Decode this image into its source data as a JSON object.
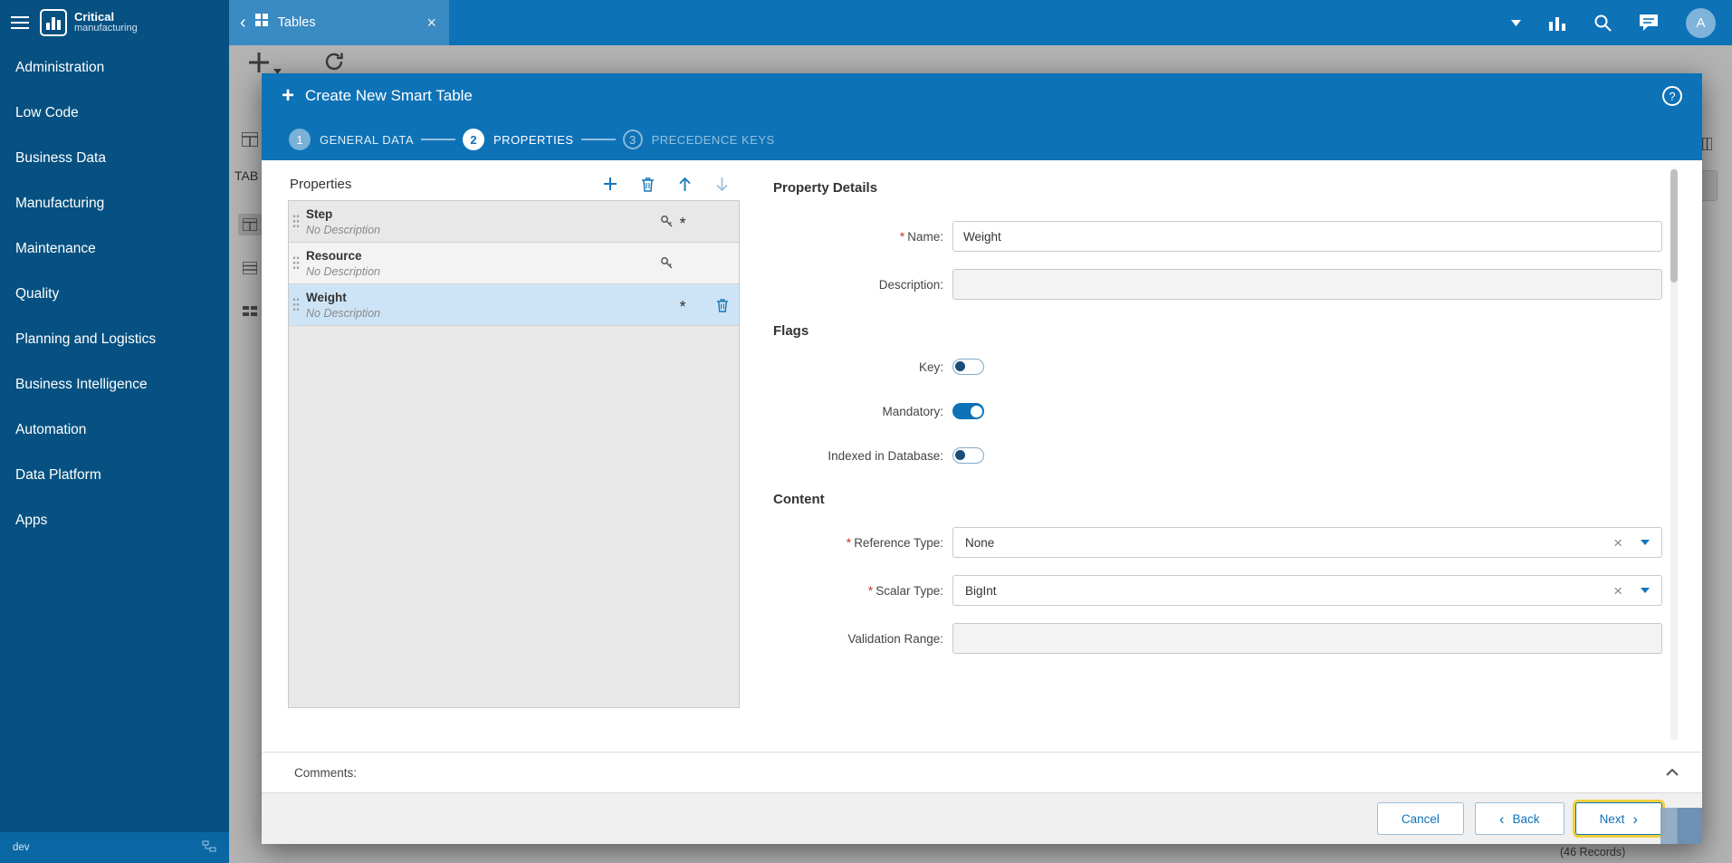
{
  "icons": {
    "plus": "+",
    "help": "?",
    "close": "×",
    "clear": "×",
    "required": "*",
    "back_chevron": "‹",
    "forward_chevron": "›"
  },
  "colors": {
    "topbar": "#0e72b7",
    "sidebar": "#065181",
    "accent": "#1677b8",
    "selected_row": "#cde4f6",
    "focus_ring": "#f2cf3e"
  },
  "sidebar": {
    "logo_primary": "Critical",
    "logo_secondary": "manufacturing",
    "items": [
      {
        "label": "Administration"
      },
      {
        "label": "Low Code"
      },
      {
        "label": "Business Data"
      },
      {
        "label": "Manufacturing"
      },
      {
        "label": "Maintenance"
      },
      {
        "label": "Quality"
      },
      {
        "label": "Planning and Logistics"
      },
      {
        "label": "Business Intelligence"
      },
      {
        "label": "Automation"
      },
      {
        "label": "Data Platform"
      },
      {
        "label": "Apps"
      }
    ],
    "environment": "dev"
  },
  "topbar": {
    "tab_label": "Tables",
    "avatar_initial": "A"
  },
  "background": {
    "page_title_partial": "TAB",
    "records_count": "(46 Records)"
  },
  "wizard": {
    "title": "Create New Smart Table",
    "steps": [
      {
        "number": "1",
        "label": "GENERAL DATA",
        "state": "completed"
      },
      {
        "number": "2",
        "label": "PROPERTIES",
        "state": "active"
      },
      {
        "number": "3",
        "label": "PRECEDENCE KEYS",
        "state": "upcoming"
      }
    ],
    "properties_panel": {
      "title": "Properties",
      "items": [
        {
          "name": "Step",
          "description": "No Description",
          "is_key": true,
          "is_mandatory": true,
          "selected": false
        },
        {
          "name": "Resource",
          "description": "No Description",
          "is_key": true,
          "is_mandatory": false,
          "selected": false
        },
        {
          "name": "Weight",
          "description": "No Description",
          "is_key": false,
          "is_mandatory": true,
          "selected": true
        }
      ]
    },
    "details": {
      "title": "Property Details",
      "sections": {
        "flags": "Flags",
        "content": "Content"
      },
      "fields": {
        "name": {
          "label": "Name:",
          "value": "Weight",
          "required": true
        },
        "description": {
          "label": "Description:",
          "value": "",
          "required": false
        },
        "reference_type": {
          "label": "Reference Type:",
          "value": "None",
          "required": true
        },
        "scalar_type": {
          "label": "Scalar Type:",
          "value": "BigInt",
          "required": true
        },
        "validation_range": {
          "label": "Validation Range:",
          "value": "",
          "required": false
        }
      },
      "toggles": {
        "key": {
          "label": "Key:",
          "on": false
        },
        "mandatory": {
          "label": "Mandatory:",
          "on": true
        },
        "indexed": {
          "label": "Indexed in Database:",
          "on": false
        }
      }
    },
    "comments_label": "Comments:",
    "buttons": {
      "cancel": "Cancel",
      "back": "Back",
      "next": "Next"
    }
  }
}
